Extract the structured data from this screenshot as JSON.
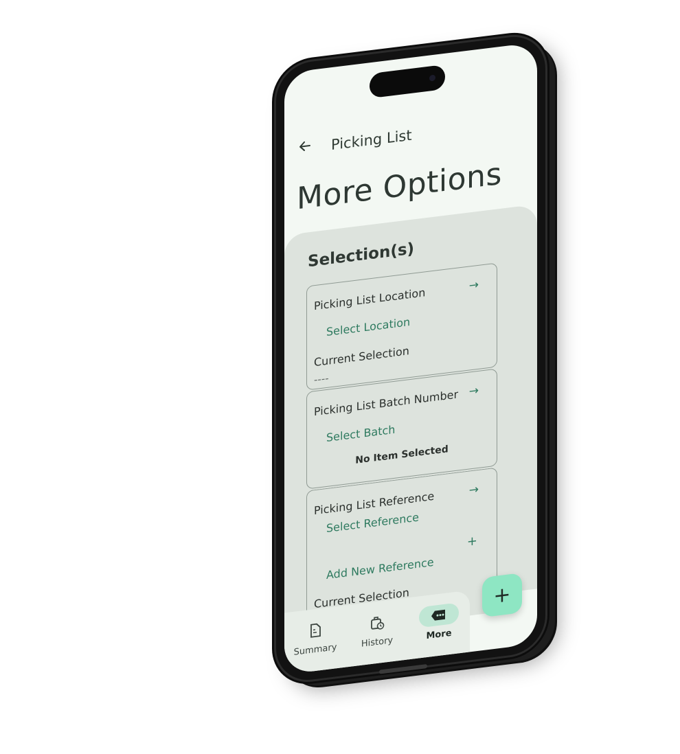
{
  "header": {
    "back_icon": "arrow-left-icon",
    "title": "Picking List"
  },
  "page": {
    "title": "More Options"
  },
  "section": {
    "title": "Selection(s)"
  },
  "cards": {
    "location": {
      "label": "Picking List Location",
      "action": "Select Location",
      "current_label": "Current Selection",
      "current_value": "----",
      "arrow_icon": "arrow-right-icon"
    },
    "batch": {
      "label": "Picking List Batch Number",
      "action": "Select Batch",
      "status": "No Item Selected",
      "arrow_icon": "arrow-right-icon"
    },
    "reference": {
      "label": "Picking List Reference",
      "action": "Select Reference",
      "add_action": "Add New Reference",
      "current_label": "Current Selection",
      "current_value": "----",
      "arrow_icon": "arrow-right-icon",
      "plus_icon": "plus-icon"
    }
  },
  "nav": {
    "items": [
      {
        "label": "Summary",
        "icon": "document-icon",
        "active": false
      },
      {
        "label": "History",
        "icon": "clock-icon",
        "active": false
      },
      {
        "label": "More",
        "icon": "more-tag-icon",
        "active": true
      }
    ]
  },
  "fab": {
    "label": "+",
    "icon": "plus-icon"
  },
  "colors": {
    "accent": "#2e7a5f",
    "fab": "#8ee6c3",
    "active_pill": "#bfe6d4",
    "screen_bg": "#f3f8f3",
    "sheet_bg": "#dde3dd"
  }
}
